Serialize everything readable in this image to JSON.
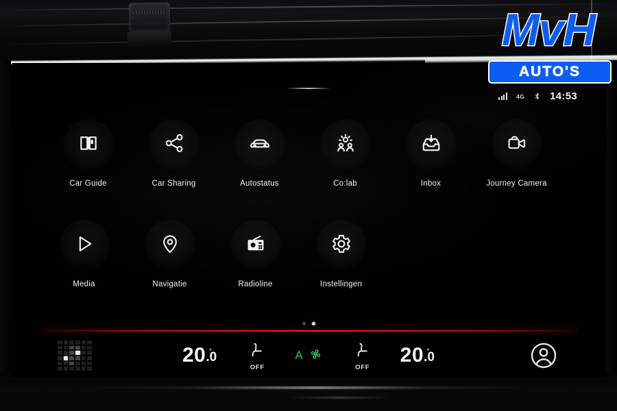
{
  "vehicle_display": {
    "status_bar": {
      "signal_icon": "signal-bars-icon",
      "network": "4G",
      "bluetooth_icon": "bluetooth-icon",
      "time": "14:53"
    },
    "drag_handle": "screen-drag-handle",
    "app_rows": [
      [
        {
          "label": "Car Guide",
          "icon": "book-icon"
        },
        {
          "label": "Car Sharing",
          "icon": "share-icon"
        },
        {
          "label": "Autostatus",
          "icon": "car-icon"
        },
        {
          "label": "Co:lab",
          "icon": "people-lightbulb-icon"
        },
        {
          "label": "Inbox",
          "icon": "inbox-tray-icon"
        },
        {
          "label": "Journey Camera",
          "icon": "video-camera-icon"
        }
      ],
      [
        {
          "label": "Media",
          "icon": "play-icon"
        },
        {
          "label": "Navigatie",
          "icon": "map-pin-icon"
        },
        {
          "label": "Radioline",
          "icon": "radio-icon"
        },
        {
          "label": "Instellingen",
          "icon": "gear-icon"
        }
      ]
    ],
    "pagination": {
      "total": 2,
      "active_index": 1
    },
    "climate_bar": {
      "grid_icon": "dot-grid-icon",
      "left_temperature": {
        "whole": "20",
        "decimal": ".0",
        "degree": "°"
      },
      "left_seat": {
        "icon": "seat-icon",
        "state": "OFF"
      },
      "auto_climate": {
        "letter": "A",
        "icon": "fan-icon",
        "color": "#22c55e"
      },
      "right_seat": {
        "icon": "seat-icon",
        "state": "OFF"
      },
      "right_temperature": {
        "whole": "20",
        "decimal": ".0",
        "degree": "°"
      },
      "profile_icon": "user-avatar-icon"
    },
    "accent_color": "#ff2020"
  },
  "watermark": {
    "brand": "MvH",
    "tagline": "AUTO'S",
    "brand_color": "#0d5ef0"
  }
}
